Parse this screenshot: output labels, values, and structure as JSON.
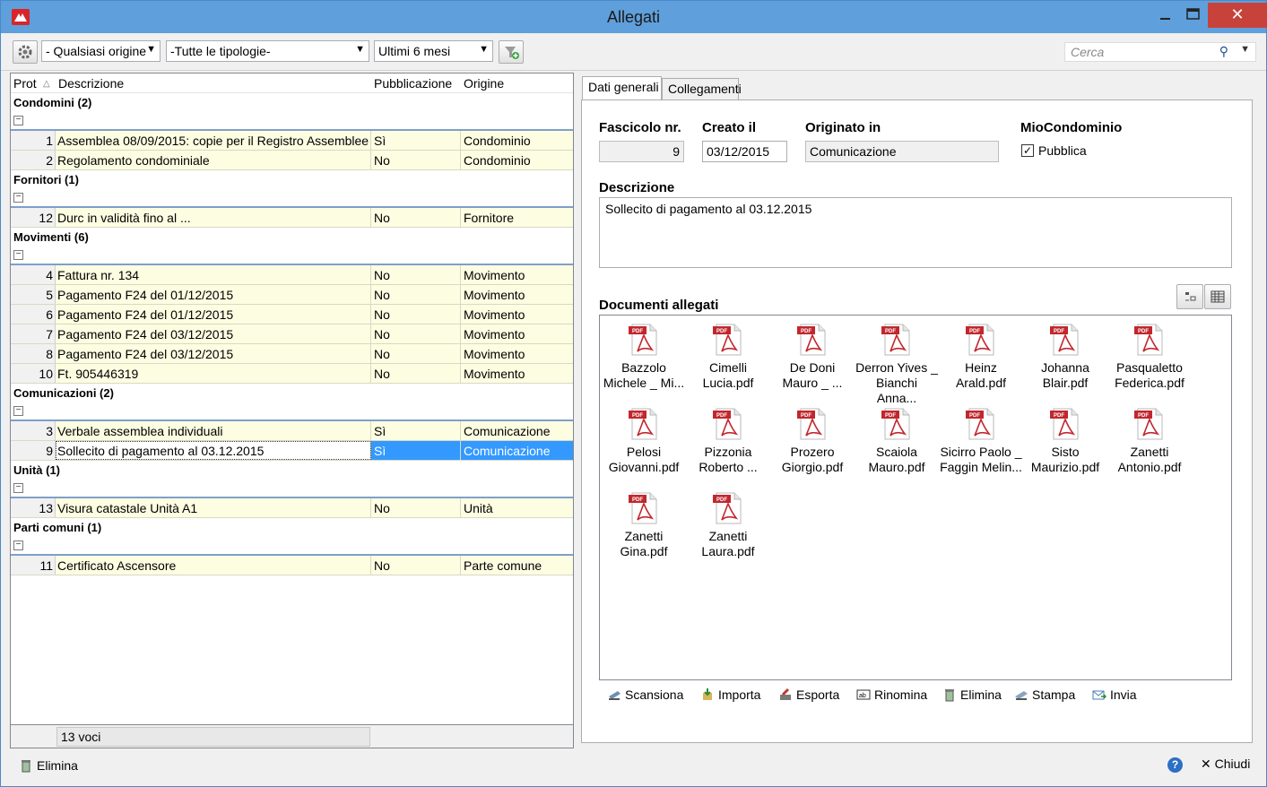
{
  "window": {
    "title": "Allegati"
  },
  "toolbar": {
    "origin_select": "- Qualsiasi origine",
    "type_select": "-Tutte le tipologie-",
    "period_select": "Ultimi 6 mesi",
    "search_placeholder": "Cerca"
  },
  "grid": {
    "headers": [
      "Prot",
      "Descrizione",
      "Pubblicazione",
      "Origine"
    ],
    "groups": [
      {
        "title": "Condomini (2)",
        "rows": [
          {
            "prot": "1",
            "descr": "Assemblea 08/09/2015: copie per il Registro Assemblee",
            "pub": "Sì",
            "orig": "Condominio"
          },
          {
            "prot": "2",
            "descr": "Regolamento condominiale",
            "pub": "No",
            "orig": "Condominio"
          }
        ]
      },
      {
        "title": "Fornitori (1)",
        "rows": [
          {
            "prot": "12",
            "descr": "Durc in validità fino al ...",
            "pub": "No",
            "orig": "Fornitore"
          }
        ]
      },
      {
        "title": "Movimenti (6)",
        "rows": [
          {
            "prot": "4",
            "descr": "Fattura nr. 134",
            "pub": "No",
            "orig": "Movimento"
          },
          {
            "prot": "5",
            "descr": "Pagamento F24 del 01/12/2015",
            "pub": "No",
            "orig": "Movimento"
          },
          {
            "prot": "6",
            "descr": "Pagamento F24 del 01/12/2015",
            "pub": "No",
            "orig": "Movimento"
          },
          {
            "prot": "7",
            "descr": "Pagamento F24 del 03/12/2015",
            "pub": "No",
            "orig": "Movimento"
          },
          {
            "prot": "8",
            "descr": "Pagamento F24 del 03/12/2015",
            "pub": "No",
            "orig": "Movimento"
          },
          {
            "prot": "10",
            "descr": "Ft. 905446319",
            "pub": "No",
            "orig": "Movimento"
          }
        ]
      },
      {
        "title": "Comunicazioni (2)",
        "rows": [
          {
            "prot": "3",
            "descr": "Verbale assemblea individuali",
            "pub": "Sì",
            "orig": "Comunicazione"
          },
          {
            "prot": "9",
            "descr": "Sollecito di pagamento al 03.12.2015",
            "pub": "Sì",
            "orig": "Comunicazione",
            "selected": true
          }
        ]
      },
      {
        "title": "Unità (1)",
        "rows": [
          {
            "prot": "13",
            "descr": "Visura catastale Unità A1",
            "pub": "No",
            "orig": "Unità"
          }
        ]
      },
      {
        "title": "Parti comuni (1)",
        "rows": [
          {
            "prot": "11",
            "descr": "Certificato Ascensore",
            "pub": "No",
            "orig": "Parte comune"
          }
        ]
      }
    ],
    "footer_count": "13 voci",
    "selection_color": "#3399ff",
    "row_color": "#fdfde2"
  },
  "tabs": [
    "Dati generali",
    "Collegamenti"
  ],
  "form": {
    "fascicolo_label": "Fascicolo nr.",
    "fascicolo_value": "9",
    "creato_label": "Creato il",
    "creato_value": "03/12/2015",
    "originato_label": "Originato in",
    "originato_value": "Comunicazione",
    "mio_label": "MioCondominio",
    "pubblica_label": "Pubblica",
    "pubblica_checked": true,
    "descrizione_label": "Descrizione",
    "descrizione_value": "Sollecito di pagamento al 03.12.2015",
    "documenti_label": "Documenti allegati"
  },
  "documents": [
    {
      "line1": "Bazzolo",
      "line2": "Michele _ Mi..."
    },
    {
      "line1": "Cimelli",
      "line2": "Lucia.pdf"
    },
    {
      "line1": "De Doni",
      "line2": "Mauro _ ..."
    },
    {
      "line1": "Derron Yives _",
      "line2": "Bianchi Anna..."
    },
    {
      "line1": "Heinz Arald.pdf",
      "line2": ""
    },
    {
      "line1": "Johanna",
      "line2": "Blair.pdf"
    },
    {
      "line1": "Pasqualetto",
      "line2": "Federica.pdf"
    },
    {
      "line1": "Pelosi",
      "line2": "Giovanni.pdf"
    },
    {
      "line1": "Pizzonia",
      "line2": "Roberto ..."
    },
    {
      "line1": "Prozero",
      "line2": "Giorgio.pdf"
    },
    {
      "line1": "Scaiola",
      "line2": "Mauro.pdf"
    },
    {
      "line1": "Sicirro Paolo _",
      "line2": "Faggin Melin..."
    },
    {
      "line1": "Sisto",
      "line2": "Maurizio.pdf"
    },
    {
      "line1": "Zanetti",
      "line2": "Antonio.pdf"
    },
    {
      "line1": "Zanetti",
      "line2": "Gina.pdf"
    },
    {
      "line1": "Zanetti",
      "line2": "Laura.pdf"
    }
  ],
  "doc_actions": [
    "Scansiona",
    "Importa",
    "Esporta",
    "Rinomina",
    "Elimina",
    "Stampa",
    "Invia"
  ],
  "bottom": {
    "delete_label": "Elimina",
    "close_label": "Chiudi"
  }
}
